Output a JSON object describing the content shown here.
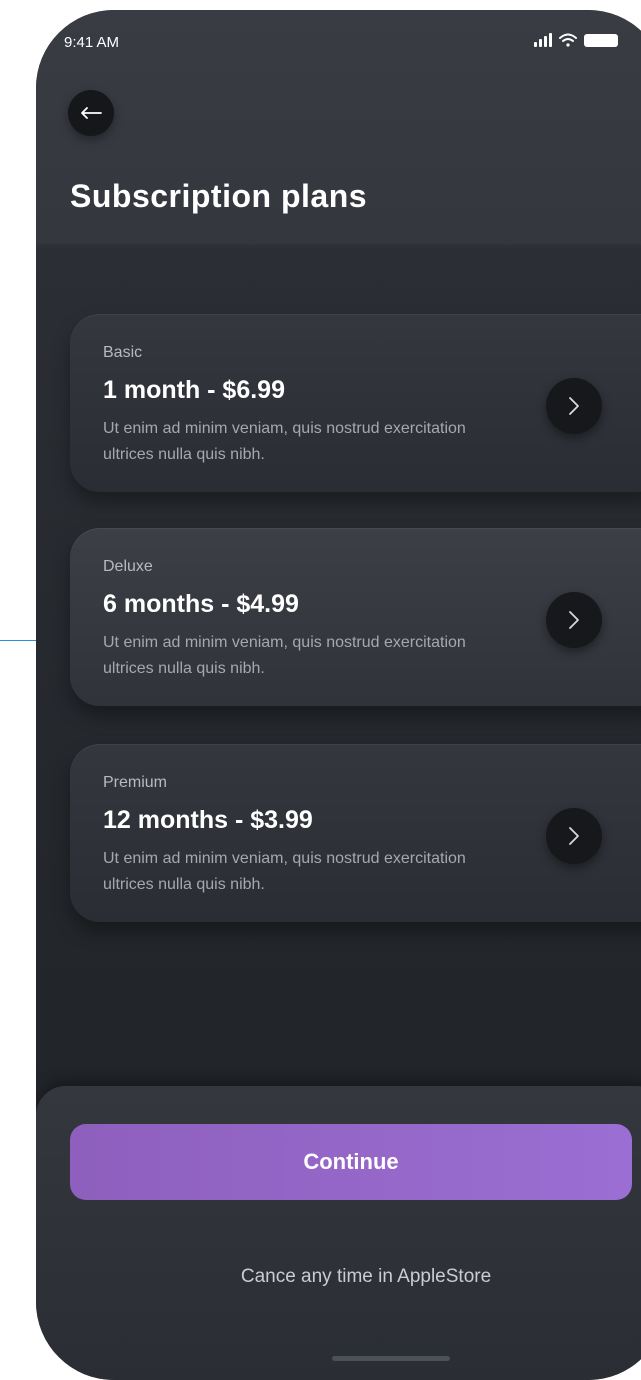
{
  "status_bar": {
    "time": "9:41 AM"
  },
  "header": {
    "title": "Subscription plans"
  },
  "plans": [
    {
      "tier": "Basic",
      "price": "1 month - $6.99",
      "description": "Ut enim ad minim veniam, quis nostrud exercitation ultrices nulla quis nibh."
    },
    {
      "tier": "Deluxe",
      "price": "6 months - $4.99",
      "description": "Ut enim ad minim veniam, quis nostrud exercitation ultrices nulla quis nibh."
    },
    {
      "tier": "Premium",
      "price": "12 months - $3.99",
      "description": "Ut enim ad minim veniam, quis nostrud exercitation ultrices nulla quis nibh."
    }
  ],
  "footer": {
    "continue_label": "Continue",
    "note": "Cance any time in AppleStore"
  },
  "colors": {
    "accent": "#9467c8",
    "background": "#2b2e34",
    "card": "#33363d"
  },
  "icons": [
    "back-arrow-icon",
    "chevron-right-icon",
    "signal-icon",
    "wifi-icon",
    "battery-icon"
  ]
}
